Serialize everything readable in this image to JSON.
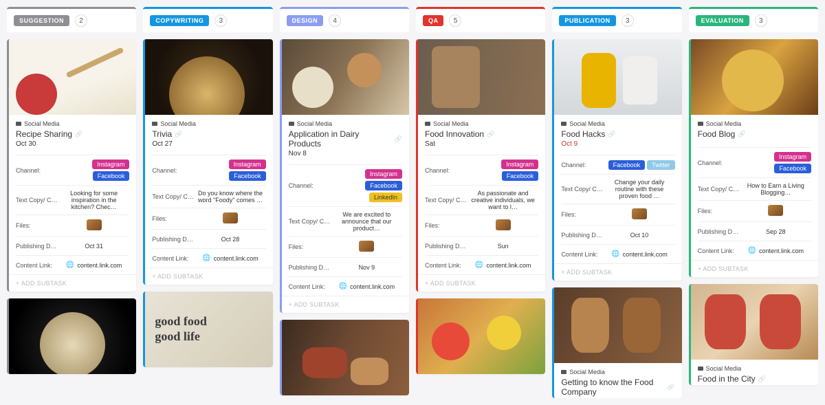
{
  "columns": [
    {
      "id": "suggestion",
      "label": "SUGGESTION",
      "count": "2",
      "accent": "#8e8e93"
    },
    {
      "id": "copywriting",
      "label": "COPYWRITING",
      "count": "3",
      "accent": "#1496e0"
    },
    {
      "id": "design",
      "label": "DESIGN",
      "count": "4",
      "accent": "#8a9df0"
    },
    {
      "id": "qa",
      "label": "QA",
      "count": "5",
      "accent": "#e0342c"
    },
    {
      "id": "publication",
      "label": "PUBLICATION",
      "count": "3",
      "accent": "#1496e0"
    },
    {
      "id": "evaluation",
      "label": "EVALUATION",
      "count": "3",
      "accent": "#2ab57d"
    }
  ],
  "labels": {
    "category": "Social Media",
    "channel": "Channel:",
    "textcopy": "Text Copy/ C…",
    "files": "Files:",
    "pubdate": "Publishing D…",
    "contentlink": "Content Link:",
    "addsub": "+ ADD SUBTASK",
    "goodfood": "good food\ngood life"
  },
  "cards": {
    "suggestion": [
      {
        "title": "Recipe Sharing",
        "date": "Oct 30",
        "channels": [
          "Instagram",
          "Facebook"
        ],
        "copy": "Looking for some inspiration in the kitchen? Chec…",
        "pub": "Oct 31",
        "link": "content.link.com",
        "img": "img-0"
      },
      {
        "title": "",
        "date": "",
        "channels": [],
        "copy": "",
        "pub": "",
        "link": "",
        "img": "img-6",
        "partial": true
      }
    ],
    "copywriting": [
      {
        "title": "Trivia",
        "date": "Oct 27",
        "channels": [
          "Instagram",
          "Facebook"
        ],
        "copy": "Do you know where the word \"Foody\" comes …",
        "pub": "Oct 28",
        "link": "content.link.com",
        "img": "img-1"
      },
      {
        "title": "",
        "date": "",
        "channels": [],
        "copy": "",
        "pub": "",
        "link": "",
        "img": "img-7",
        "partial": true,
        "textimg": true
      }
    ],
    "design": [
      {
        "title": "Application in Dairy Products",
        "date": "Nov 8",
        "channels": [
          "Instagram",
          "Facebook",
          "LinkedIn"
        ],
        "copy": "We are excited to announce that our product…",
        "pub": "Nov 9",
        "link": "content.link.com",
        "img": "img-2"
      },
      {
        "title": "",
        "date": "",
        "channels": [],
        "copy": "",
        "pub": "",
        "link": "",
        "img": "img-8",
        "partial": true
      }
    ],
    "qa": [
      {
        "title": "Food Innovation",
        "date": "Sat",
        "channels": [
          "Instagram",
          "Facebook"
        ],
        "copy": "As passionate and creative individuals, we want to l…",
        "pub": "Sun",
        "link": "content.link.com",
        "img": "img-3"
      },
      {
        "title": "",
        "date": "",
        "channels": [],
        "copy": "",
        "pub": "",
        "link": "",
        "img": "img-9",
        "partial": true
      }
    ],
    "publication": [
      {
        "title": "Food Hacks",
        "date": "Oct 9",
        "dateRed": true,
        "channels": [
          "Facebook",
          "Twitter"
        ],
        "copy": "Change your daily routine with these proven food …",
        "pub": "Oct 10",
        "link": "content.link.com",
        "img": "img-4"
      },
      {
        "title": "Getting to know the Food Company",
        "date": "",
        "channels": [],
        "copy": "",
        "pub": "",
        "link": "",
        "img": "img-10",
        "partial": true,
        "showCat": true
      }
    ],
    "evaluation": [
      {
        "title": "Food Blog",
        "date": "",
        "channels": [
          "Instagram",
          "Facebook"
        ],
        "copy": "How to Earn a Living Blogging…",
        "pub": "Sep 28",
        "link": "content.link.com",
        "img": "img-5",
        "files": true
      },
      {
        "title": "Food in the City",
        "date": "",
        "channels": [],
        "copy": "",
        "pub": "",
        "link": "",
        "img": "img-11",
        "partial": true,
        "showCat": true
      }
    ]
  }
}
